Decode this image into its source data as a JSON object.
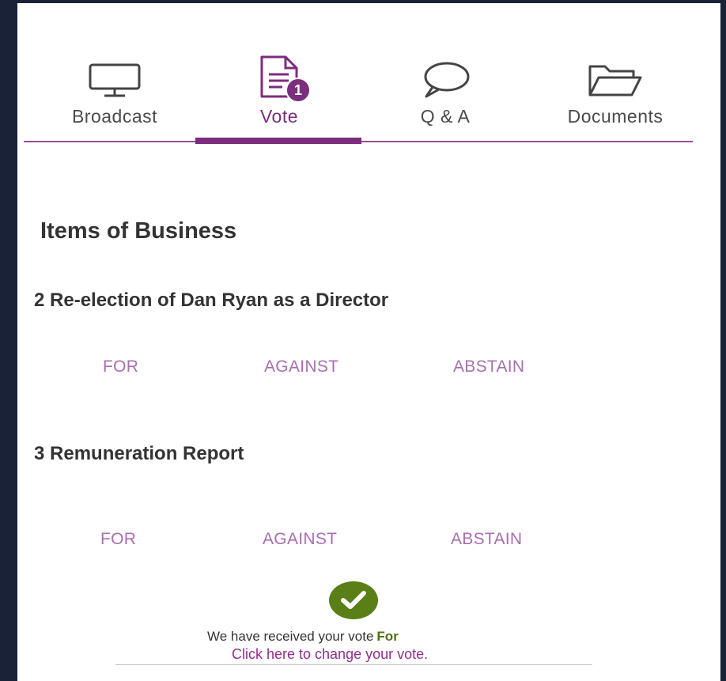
{
  "tabs": [
    {
      "label": "Broadcast",
      "icon": "monitor-icon"
    },
    {
      "label": "Vote",
      "icon": "document-icon",
      "badge": "1",
      "active": true
    },
    {
      "label": "Q & A",
      "icon": "speech-bubble-icon"
    },
    {
      "label": "Documents",
      "icon": "folder-icon"
    }
  ],
  "main": {
    "heading": "Items of Business",
    "items": [
      {
        "title": "2 Re-election of Dan Ryan as a Director",
        "options": [
          "FOR",
          "AGAINST",
          "ABSTAIN"
        ]
      },
      {
        "title": "3 Remuneration Report",
        "options": [
          "FOR",
          "AGAINST",
          "ABSTAIN"
        ]
      }
    ]
  },
  "confirmation": {
    "message": "We have received your vote",
    "vote": "For",
    "change_link": "Click here to change your vote."
  },
  "colors": {
    "accent": "#7b2d7e",
    "option_text": "#a86fb0",
    "success": "#5a7f16"
  }
}
